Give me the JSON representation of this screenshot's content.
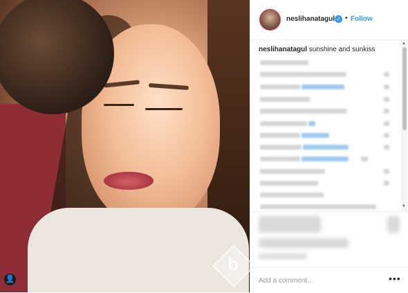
{
  "post": {
    "username": "neslihanatagul",
    "verified_icon": "verified-badge-icon",
    "separator": "•",
    "follow_label": "Follow",
    "caption_user": "neslihanatagul",
    "caption_text": "sunshine and sunkiss",
    "add_comment_placeholder": "Add a comment...",
    "more_label": "•••",
    "watermark_letter": "b",
    "tag_icon_glyph": "👤"
  },
  "colors": {
    "accent": "#3897f0",
    "text": "#262626",
    "border": "#efefef",
    "story_ring": "#e1306c"
  }
}
